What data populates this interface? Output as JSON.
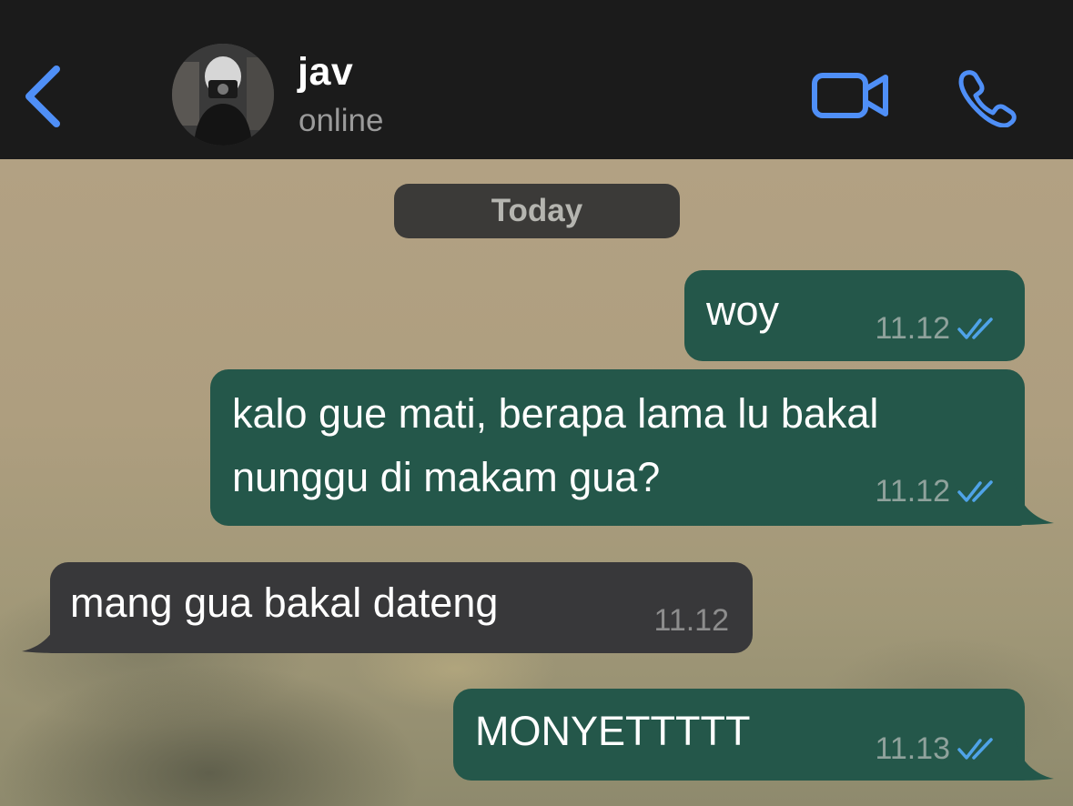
{
  "header": {
    "contact_name": "jav",
    "status": "online",
    "icons": {
      "back": "chevron-left-icon",
      "video": "video-camera-icon",
      "call": "phone-icon"
    },
    "accent_color": "#4f8ff7"
  },
  "chat": {
    "date_label": "Today",
    "messages": [
      {
        "direction": "outgoing",
        "lines": [
          "woy"
        ],
        "time": "11.12",
        "status": "read"
      },
      {
        "direction": "outgoing",
        "lines": [
          "kalo gue mati, berapa lama lu bakal",
          "nunggu di makam gua?"
        ],
        "time": "11.12",
        "status": "read"
      },
      {
        "direction": "incoming",
        "lines": [
          "mang gua bakal dateng"
        ],
        "time": "11.12"
      },
      {
        "direction": "outgoing",
        "lines": [
          "MONYETTTTT"
        ],
        "time": "11.13",
        "status": "read"
      }
    ],
    "colors": {
      "outgoing_bubble": "#24574a",
      "incoming_bubble": "#38383a",
      "read_ticks": "#4fa3e8"
    }
  }
}
